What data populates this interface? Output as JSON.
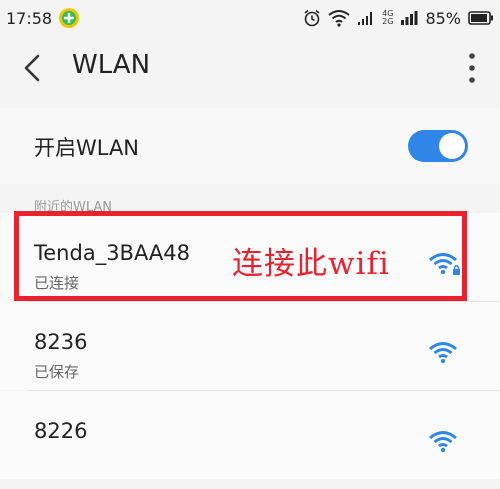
{
  "status_bar": {
    "time": "17:58",
    "network_label_top": "4G",
    "network_label_bottom": "2G",
    "battery": "85%"
  },
  "app_bar": {
    "title": "WLAN"
  },
  "wlan_toggle": {
    "label": "开启WLAN",
    "enabled": true
  },
  "section_header": "附近的WLAN",
  "networks": [
    {
      "name": "Tenda_3BAA48",
      "status": "已连接",
      "locked": true
    },
    {
      "name": "8236",
      "status": "已保存",
      "locked": false
    },
    {
      "name": "8226",
      "status": "",
      "locked": false
    }
  ],
  "annotation": {
    "text": "连接此wifi",
    "color": "#e8232f"
  },
  "colors": {
    "accent": "#2f86e8",
    "highlight": "#e8232f"
  }
}
